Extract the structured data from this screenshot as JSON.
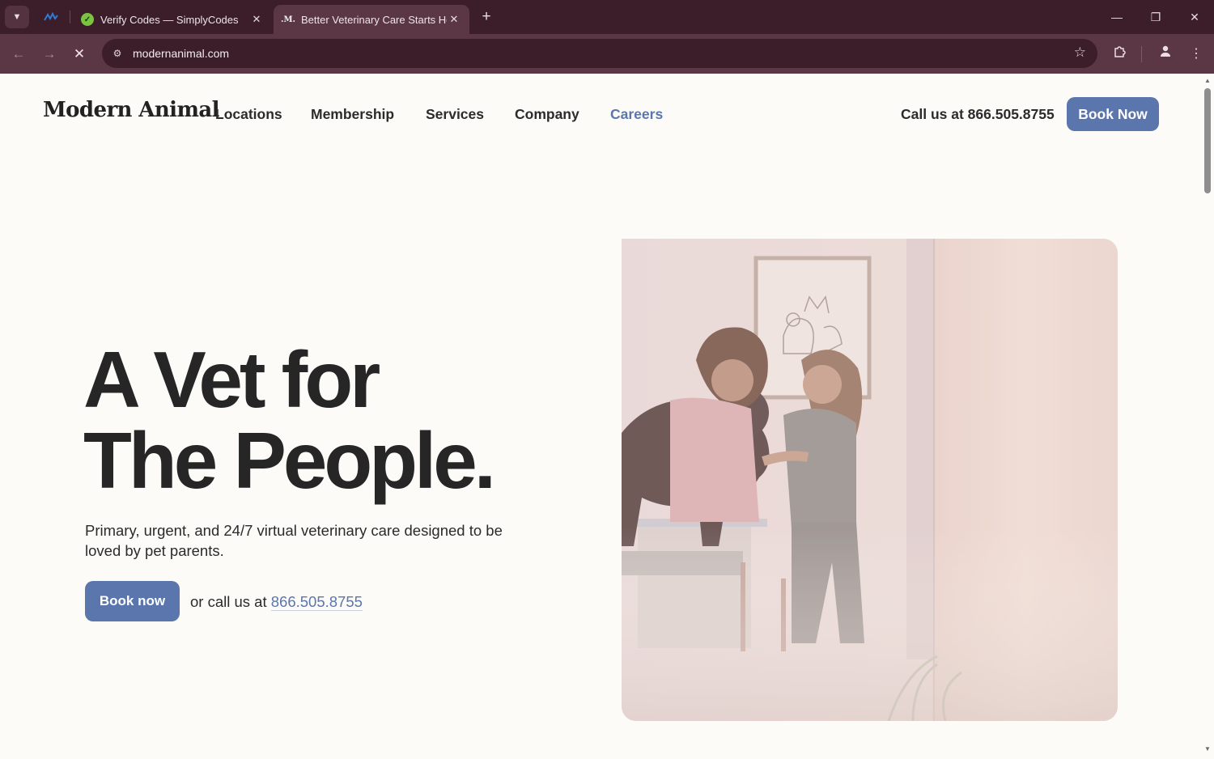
{
  "browser": {
    "tabs": [
      {
        "title": "Verify Codes — SimplyCodes",
        "active": false
      },
      {
        "title": "Better Veterinary Care Starts Here",
        "active": true
      }
    ],
    "url": "modernanimal.com",
    "colors": {
      "frame": "#3b1e2a",
      "toolbar": "#5b3645"
    }
  },
  "site": {
    "logo": "Modern Animal",
    "nav": {
      "locations": "Locations",
      "membership": "Membership",
      "services": "Services",
      "company": "Company",
      "careers": "Careers"
    },
    "call_header": "Call us at 866.505.8755",
    "book_header": "Book Now"
  },
  "hero": {
    "title_line1": "A Vet for",
    "title_line2": "The People.",
    "subtitle": "Primary, urgent, and 24/7 virtual veterinary care designed to be loved by pet parents.",
    "cta": "Book now",
    "call_prefix": "or call us at",
    "phone": "866.505.8755"
  },
  "colors": {
    "accent": "#5a76ad",
    "background": "#fcfbf7",
    "text": "#262626"
  }
}
